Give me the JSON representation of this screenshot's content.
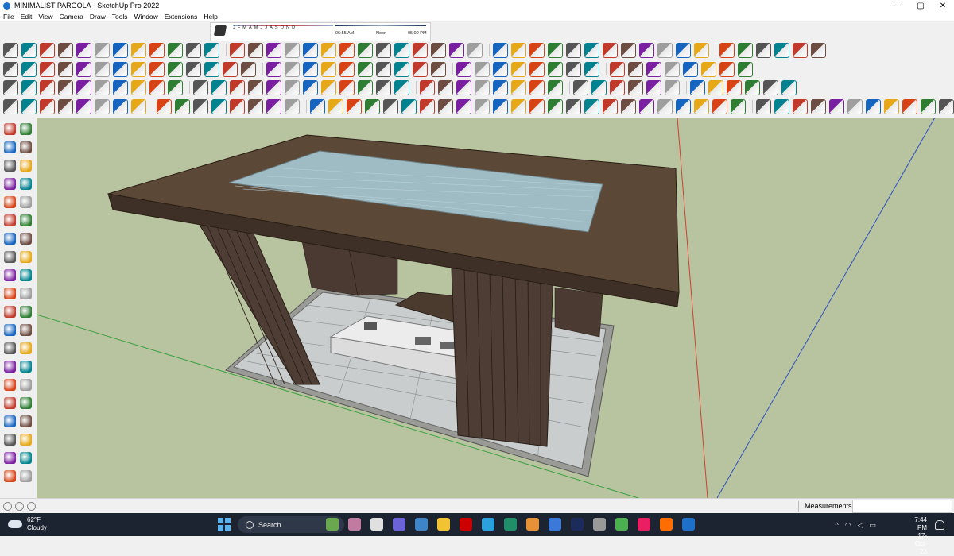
{
  "window": {
    "title": "MINIMALIST PARGOLA - SketchUp Pro 2022",
    "minimize": "—",
    "maximize": "▢",
    "close": "✕"
  },
  "menu": [
    "File",
    "Edit",
    "View",
    "Camera",
    "Draw",
    "Tools",
    "Window",
    "Extensions",
    "Help"
  ],
  "shadow_panel": {
    "months": "JFMAMJJASOND",
    "time_start": "06:55 AM",
    "time_mid": "Noon",
    "time_end": "05:00 PM"
  },
  "status": {
    "measurements_label": "Measurements",
    "measurements_value": ""
  },
  "taskbar": {
    "temperature": "62°F",
    "condition": "Cloudy",
    "search_placeholder": "Search",
    "time": "7:44 PM",
    "date": "17-Oct-23",
    "tray_chevron": "^"
  },
  "colors": {
    "viewport_bg": "#b8c4a0",
    "roof": "#5e4a3a",
    "glass": "#9fbcc4",
    "floor": "#c8cccc",
    "slats": "#4a3a32",
    "accent_blue": "#1e6fc8",
    "taskbar_bg": "#1d2431"
  },
  "icons": {
    "toolbar_row1": [
      "orbit-icon",
      "arc-icon",
      "paint-icon",
      "eraser-icon",
      "undo-icon",
      "redo-icon",
      "follow-icon",
      "push-pull-icon",
      "offset-icon",
      "section-icon"
    ],
    "weather": "cloud-icon",
    "start": "windows-start-icon"
  }
}
